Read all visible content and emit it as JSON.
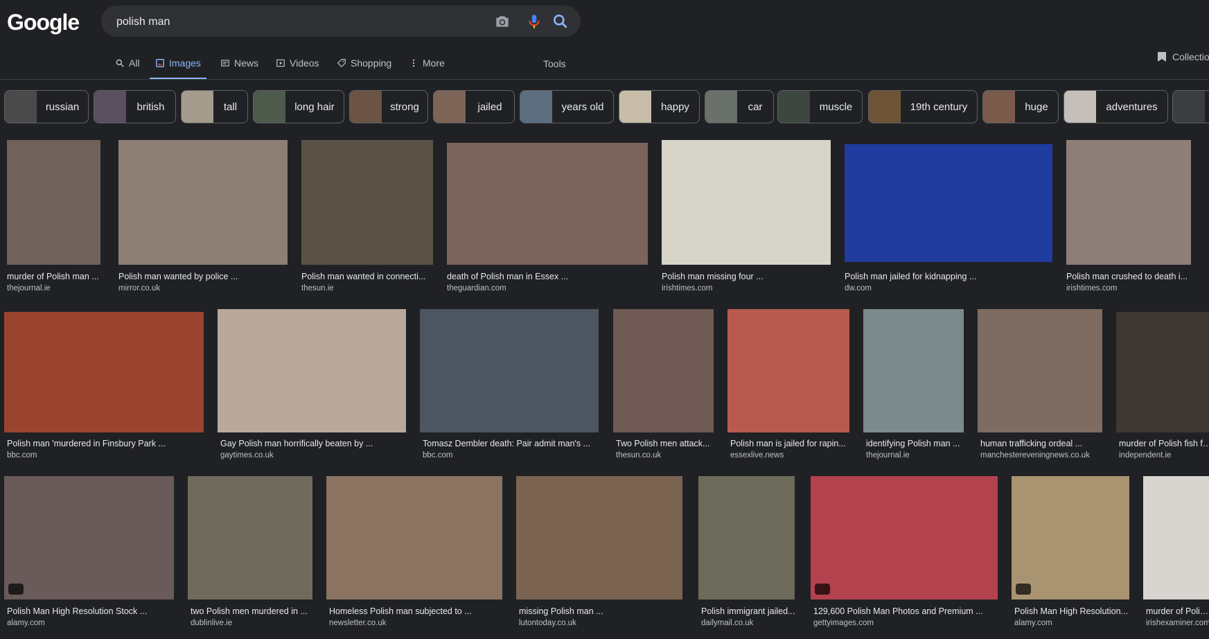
{
  "logo": "Google",
  "search": {
    "query": "polish man"
  },
  "tabs": [
    {
      "label": "All",
      "icon": "search-icon"
    },
    {
      "label": "Images",
      "icon": "image-icon",
      "active": true
    },
    {
      "label": "News",
      "icon": "news-icon"
    },
    {
      "label": "Videos",
      "icon": "video-icon"
    },
    {
      "label": "Shopping",
      "icon": "tag-icon"
    },
    {
      "label": "More",
      "icon": "more-vert-icon"
    }
  ],
  "tools_label": "Tools",
  "collections_label": "Collections",
  "chips": [
    {
      "label": "russian",
      "color": "#4a4a4a"
    },
    {
      "label": "british",
      "color": "#5a4f5f"
    },
    {
      "label": "tall",
      "color": "#a59b8c"
    },
    {
      "label": "long hair",
      "color": "#4e5a4c"
    },
    {
      "label": "strong",
      "color": "#6b5443"
    },
    {
      "label": "jailed",
      "color": "#7c6457"
    },
    {
      "label": "years old",
      "color": "#5d6e7e"
    },
    {
      "label": "happy",
      "color": "#c7bda9"
    },
    {
      "label": "car",
      "color": "#6a716b"
    },
    {
      "label": "muscle",
      "color": "#3d4640"
    },
    {
      "label": "19th century",
      "color": "#6e5436"
    },
    {
      "label": "huge",
      "color": "#7a5a4a"
    },
    {
      "label": "adventures",
      "color": "#c4bfb8"
    },
    {
      "label": "",
      "color": "#3b3d41"
    }
  ],
  "results": [
    {
      "caption": "murder of Polish man ...",
      "source": "thejournal.ie",
      "color": "#6f625a"
    },
    {
      "caption": "Polish man wanted by police ...",
      "source": "mirror.co.uk",
      "color": "#8c7f75"
    },
    {
      "caption": "Polish man wanted in connecti...",
      "source": "thesun.ie",
      "color": "#5a5247"
    },
    {
      "caption": "death of Polish man in Essex ...",
      "source": "theguardian.com",
      "color": "#7a645c"
    },
    {
      "caption": "Polish man missing four ...",
      "source": "irishtimes.com",
      "color": "#d7d4c9"
    },
    {
      "caption": "Polish man jailed for kidnapping ...",
      "source": "dw.com",
      "color": "#1f3c9e"
    },
    {
      "caption": "Polish man crushed to death i...",
      "source": "irishtimes.com",
      "color": "#8e7e78"
    },
    {
      "caption": "Polish man 'murdered in Finsbury Park ...",
      "source": "bbc.com",
      "color": "#9a4430"
    },
    {
      "caption": "Gay Polish man horrifically beaten by ...",
      "source": "gaytimes.co.uk",
      "color": "#b9a99a"
    },
    {
      "caption": "Tomasz Dembler death: Pair admit man's ...",
      "source": "bbc.com",
      "color": "#4d5660"
    },
    {
      "caption": "Two Polish men attack...",
      "source": "thesun.co.uk",
      "color": "#6f5a55"
    },
    {
      "caption": "Polish man is jailed for rapin...",
      "source": "essexlive.news",
      "color": "#b85a4f"
    },
    {
      "caption": "identifying Polish man ...",
      "source": "thejournal.ie",
      "color": "#7b8a8a"
    },
    {
      "caption": "human trafficking ordeal ...",
      "source": "manchestereveningnews.co.uk",
      "color": "#7e6b62"
    },
    {
      "caption": "murder of Polish fish fa...",
      "source": "independent.ie",
      "color": "#3e3833"
    },
    {
      "caption": "Polish Man High Resolution Stock ...",
      "source": "alamy.com",
      "color": "#6a5a5a"
    },
    {
      "caption": "two Polish men murdered in ...",
      "source": "dublinlive.ie",
      "color": "#6f6a5c"
    },
    {
      "caption": "Homeless Polish man subjected to ...",
      "source": "newsletter.co.uk",
      "color": "#8a7361"
    },
    {
      "caption": "missing Polish man ...",
      "source": "lutontoday.co.uk",
      "color": "#7a6451"
    },
    {
      "caption": "Polish immigrant jailed...",
      "source": "dailymail.co.uk",
      "color": "#6c6a5a"
    },
    {
      "caption": "129,600 Polish Man Photos and Premium ...",
      "source": "gettyimages.com",
      "color": "#b3424e"
    },
    {
      "caption": "Polish Man High Resolution...",
      "source": "alamy.com",
      "color": "#a99472"
    },
    {
      "caption": "murder of Polish...",
      "source": "irishexaminer.com",
      "color": "#d8d4cf"
    }
  ]
}
